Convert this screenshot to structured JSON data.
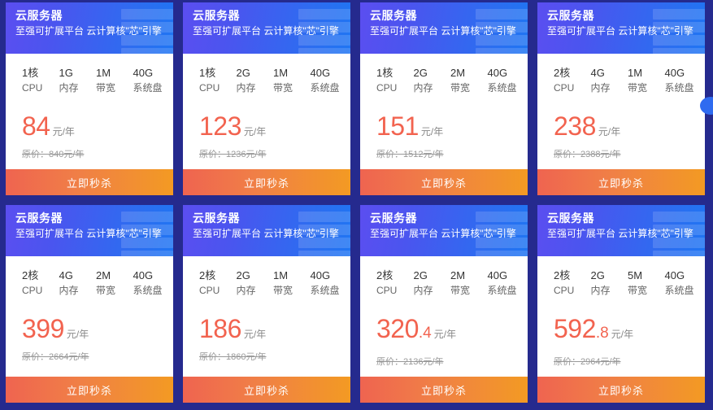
{
  "page": {
    "background_color": "#252a8e",
    "accent_price_color": "#f2634f",
    "header_gradient_from": "#5b4ef0",
    "header_gradient_to": "#1f75f2",
    "button_gradient_from": "#ef6450",
    "button_gradient_to": "#f39a23"
  },
  "common": {
    "title": "云服务器",
    "subtitle": "至强可扩展平台 云计算核\"芯\"引擎",
    "buy_label": "立即秒杀",
    "price_unit": "元/年",
    "spec_labels": [
      "CPU",
      "内存",
      "带宽",
      "系统盘"
    ],
    "orig_prefix": "原价：",
    "orig_suffix": "元/年",
    "icon": "server-rack-icon"
  },
  "cards": [
    {
      "specs": [
        "1核",
        "1G",
        "1M",
        "40G"
      ],
      "price_int": "84",
      "price_dec": "",
      "orig_price": "原价：840元/年"
    },
    {
      "specs": [
        "1核",
        "2G",
        "1M",
        "40G"
      ],
      "price_int": "123",
      "price_dec": "",
      "orig_price": "原价：1236元/年"
    },
    {
      "specs": [
        "1核",
        "2G",
        "2M",
        "40G"
      ],
      "price_int": "151",
      "price_dec": "",
      "orig_price": "原价：1512元/年"
    },
    {
      "specs": [
        "2核",
        "4G",
        "1M",
        "40G"
      ],
      "price_int": "238",
      "price_dec": "",
      "orig_price": "原价：2388元/年"
    },
    {
      "specs": [
        "2核",
        "4G",
        "2M",
        "40G"
      ],
      "price_int": "399",
      "price_dec": "",
      "orig_price": "原价：2664元/年"
    },
    {
      "specs": [
        "2核",
        "2G",
        "1M",
        "40G"
      ],
      "price_int": "186",
      "price_dec": "",
      "orig_price": "原价：1860元/年"
    },
    {
      "specs": [
        "2核",
        "2G",
        "2M",
        "40G"
      ],
      "price_int": "320",
      "price_dec": ".4",
      "orig_price": "原价：2136元/年"
    },
    {
      "specs": [
        "2核",
        "2G",
        "5M",
        "40G"
      ],
      "price_int": "592",
      "price_dec": ".8",
      "orig_price": "原价：2964元/年"
    }
  ]
}
